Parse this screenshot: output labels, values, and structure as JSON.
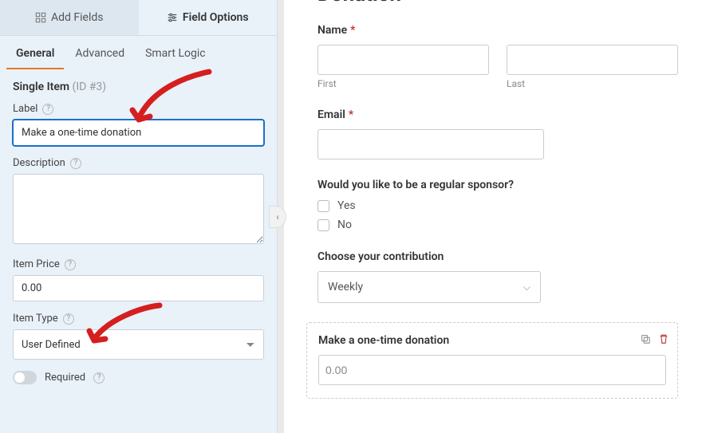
{
  "sidebar": {
    "tabs": {
      "add_fields": "Add Fields",
      "field_options": "Field Options"
    },
    "subtabs": {
      "general": "General",
      "advanced": "Advanced",
      "smart_logic": "Smart Logic"
    },
    "title": "Single Item",
    "title_id": "(ID #3)",
    "label_field": {
      "label": "Label",
      "value": "Make a one-time donation"
    },
    "description_field": {
      "label": "Description",
      "value": ""
    },
    "item_price_field": {
      "label": "Item Price",
      "value": "0.00"
    },
    "item_type_field": {
      "label": "Item Type",
      "value": "User Defined"
    },
    "required_label": "Required"
  },
  "form": {
    "heading": "Donation",
    "name": {
      "label": "Name",
      "first": "First",
      "last": "Last"
    },
    "email": {
      "label": "Email"
    },
    "sponsor": {
      "label": "Would you like to be a regular sponsor?",
      "yes": "Yes",
      "no": "No"
    },
    "contribution": {
      "label": "Choose your contribution",
      "value": "Weekly"
    },
    "donation": {
      "label": "Make a one-time donation",
      "value": "0.00"
    }
  }
}
